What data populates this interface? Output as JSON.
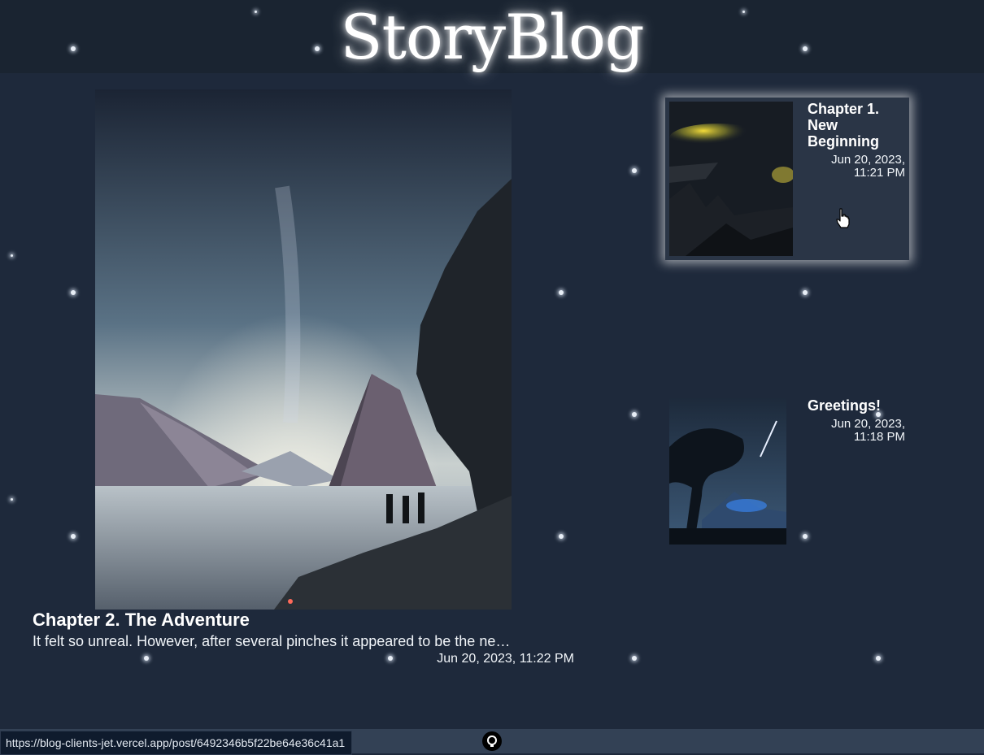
{
  "site": {
    "title": "StoryBlog"
  },
  "featured_post": {
    "title": "Chapter 2. The Adventure",
    "excerpt": "It felt so unreal. However, after several pinches it appeared to be the ne…",
    "date": "Jun 20, 2023, 11:22 PM"
  },
  "posts": [
    {
      "title": "Chapter 1. New Beginning",
      "date_line1": "Jun 20, 2023,",
      "date_line2": "11:21 PM"
    },
    {
      "title": "Greetings!",
      "date_line1": "Jun 20, 2023,",
      "date_line2": "11:18 PM"
    }
  ],
  "status_bar": {
    "url": "https://blog-clients-jet.vercel.app/post/6492346b5f22be64e36c41a1"
  },
  "footer": {
    "icon": "github-icon"
  }
}
